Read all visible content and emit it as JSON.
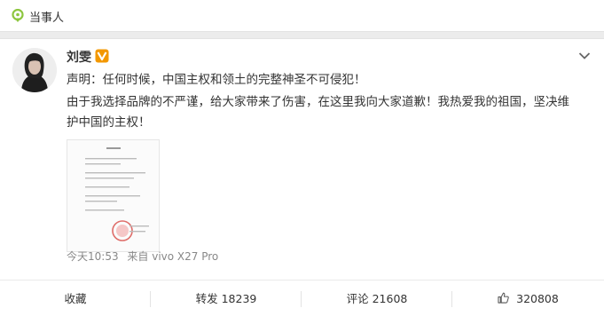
{
  "topbar": {
    "label": "当事人",
    "icon": "location-pin-icon",
    "accent": "#8dc63f"
  },
  "post": {
    "username": "刘雯",
    "verified_badge": "verified-v-icon",
    "badge_color": "#f39800",
    "line1": "声明：任何时候，中国主权和领土的完整神圣不可侵犯！",
    "line2": "由于我选择品牌的不严谨，给大家带来了伤害，在这里我向大家道歉！我热爱我的祖国，坚决维",
    "line3": "护中国的主权！",
    "time": "今天10:53",
    "source": "来自 vivo X27 Pro"
  },
  "actions": {
    "favorite": "收藏",
    "forward": "转发 18239",
    "comment": "评论 21608",
    "like": "320808"
  }
}
